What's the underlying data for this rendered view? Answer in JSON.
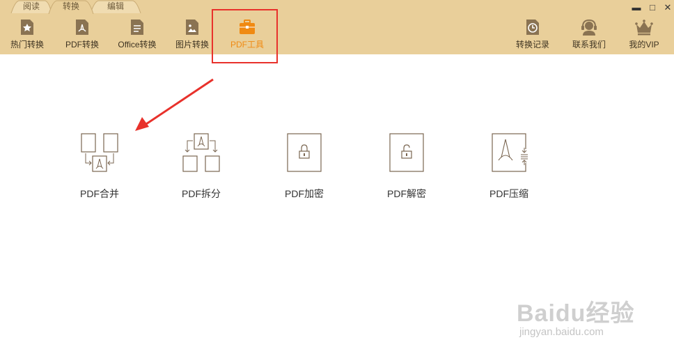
{
  "tabs": [
    {
      "label": "阅读"
    },
    {
      "label": "转换"
    },
    {
      "label": "编辑"
    }
  ],
  "window_controls": {
    "minimize": "▬",
    "maximize": "□",
    "close": "✕"
  },
  "toolbar_left": [
    {
      "label": "热门转换",
      "icon": "star-doc-icon"
    },
    {
      "label": "PDF转换",
      "icon": "pdf-doc-icon"
    },
    {
      "label": "Office转换",
      "icon": "office-doc-icon"
    },
    {
      "label": "图片转换",
      "icon": "image-doc-icon"
    },
    {
      "label": "PDF工具",
      "icon": "toolbox-icon",
      "active": true
    }
  ],
  "toolbar_right": [
    {
      "label": "转换记录",
      "icon": "history-clock-icon"
    },
    {
      "label": "联系我们",
      "icon": "headset-icon"
    },
    {
      "label": "我的VIP",
      "icon": "crown-icon"
    }
  ],
  "features": [
    {
      "label": "PDF合并",
      "icon": "merge-pdf-icon"
    },
    {
      "label": "PDF拆分",
      "icon": "split-pdf-icon"
    },
    {
      "label": "PDF加密",
      "icon": "lock-pdf-icon"
    },
    {
      "label": "PDF解密",
      "icon": "unlock-pdf-icon"
    },
    {
      "label": "PDF压缩",
      "icon": "compress-pdf-icon"
    }
  ],
  "colors": {
    "toolbar_bg": "#e9cf9a",
    "active_text": "#f08a12",
    "highlight": "#e8312b",
    "icon_brown": "#8a7352"
  },
  "watermark": {
    "main": "Baidu经验",
    "sub": "jingyan.baidu.com"
  }
}
